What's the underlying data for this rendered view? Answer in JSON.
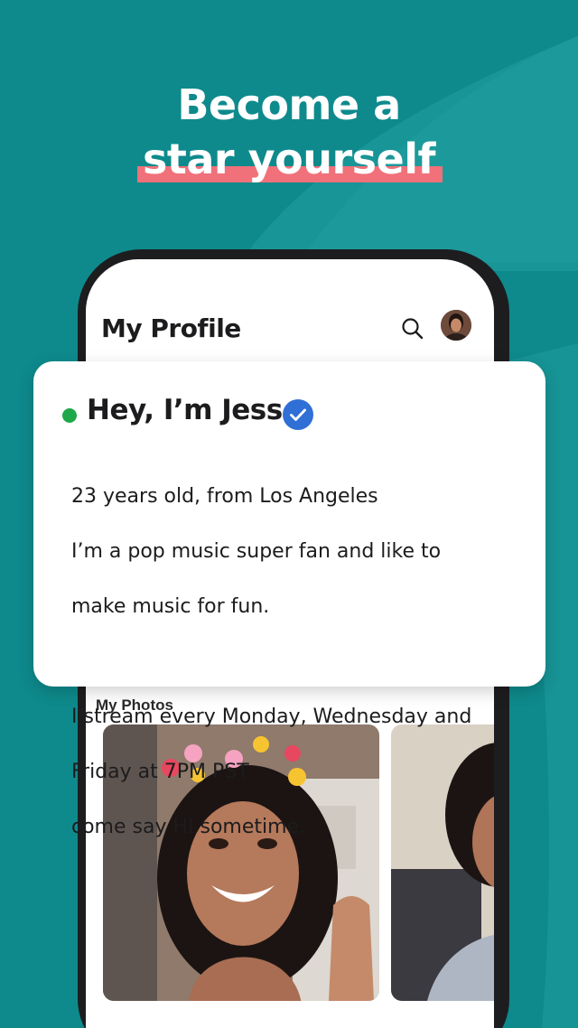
{
  "headline": {
    "line1": "Become a",
    "line2": "star yourself"
  },
  "colors": {
    "background": "#0e8a8c",
    "highlight": "#f0717a",
    "online": "#1fa84a",
    "verified": "#2f6fd6"
  },
  "app": {
    "title": "My Profile",
    "search_icon": "search-icon",
    "avatar_icon": "user-avatar"
  },
  "profile_card": {
    "name": "Hey, I’m Jess",
    "status": "online",
    "verified_icon": "verified-check-icon",
    "bio_line1": "23 years old, from Los Angeles",
    "bio_line2": "I’m a pop music super fan and like to",
    "bio_line3": "make music for fun.",
    "bio_line4": "I stream every Monday, Wednesday and",
    "bio_line5": "Friday at 7PM PST",
    "bio_line6": "come say HI sometime."
  },
  "photos": {
    "label": "My Photos"
  }
}
